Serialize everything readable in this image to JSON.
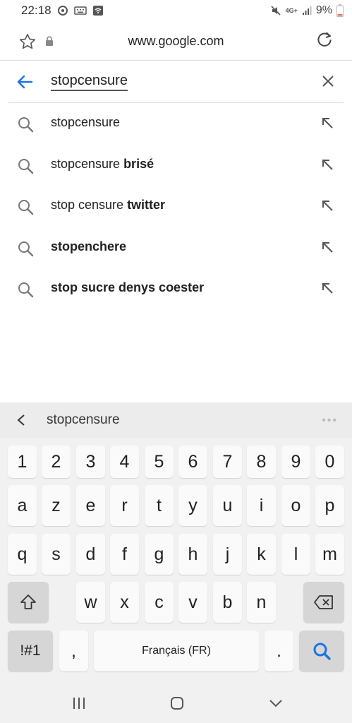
{
  "status_bar": {
    "time": "22:18",
    "network": "4G+",
    "battery": "9%"
  },
  "url_bar": {
    "url": "www.google.com"
  },
  "search": {
    "query": "stopcensure"
  },
  "suggestions": [
    {
      "plain": "stopcensure",
      "bold": ""
    },
    {
      "plain": "stopcensure ",
      "bold": "brisé"
    },
    {
      "plain": "stop censure ",
      "bold": "twitter"
    },
    {
      "plain": "",
      "bold": "stopenchere"
    },
    {
      "plain": "",
      "bold": "stop sucre denys coester"
    }
  ],
  "keyboard": {
    "prediction": "stopcensure",
    "number_row": [
      "1",
      "2",
      "3",
      "4",
      "5",
      "6",
      "7",
      "8",
      "9",
      "0"
    ],
    "row1": [
      "a",
      "z",
      "e",
      "r",
      "t",
      "y",
      "u",
      "i",
      "o",
      "p"
    ],
    "row2": [
      "q",
      "s",
      "d",
      "f",
      "g",
      "h",
      "j",
      "k",
      "l",
      "m"
    ],
    "row3": [
      "w",
      "x",
      "c",
      "v",
      "b",
      "n"
    ],
    "symbols_label": "!#1",
    "comma": ",",
    "space_label": "Français (FR)",
    "period": "."
  },
  "colors": {
    "accent": "#1a73e8",
    "keyboard_bg": "#f1f1f1",
    "dark_key": "#d6d6d6"
  }
}
